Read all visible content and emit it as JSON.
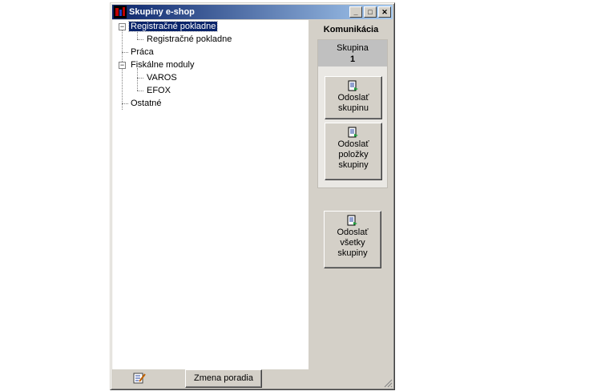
{
  "window": {
    "title": "Skupiny e-shop",
    "controls": {
      "minimize": "_",
      "maximize": "□",
      "close": "✕"
    }
  },
  "tree": {
    "nodes": [
      {
        "label": "Registračné pokladne",
        "selected": true,
        "expanded": true
      },
      {
        "label": "Registračné pokladne"
      },
      {
        "label": "Práca"
      },
      {
        "label": "Fiskálne moduly",
        "expanded": true
      },
      {
        "label": "VAROS"
      },
      {
        "label": "EFOX"
      },
      {
        "label": "Ostatné"
      }
    ]
  },
  "communication": {
    "title": "Komunikácia",
    "group_label": "Skupina",
    "group_number": "1",
    "send_group_label": "Odoslať skupinu",
    "send_items_label": "Odoslať položky skupiny",
    "send_all_label": "Odoslať všetky skupiny"
  },
  "bottom": {
    "change_order_label": "Zmena poradia",
    "edit_icon": "edit-icon"
  },
  "colors": {
    "title_start": "#0a246a",
    "title_end": "#a6caf0",
    "selection": "#0a246a",
    "face": "#d4d0c8"
  }
}
